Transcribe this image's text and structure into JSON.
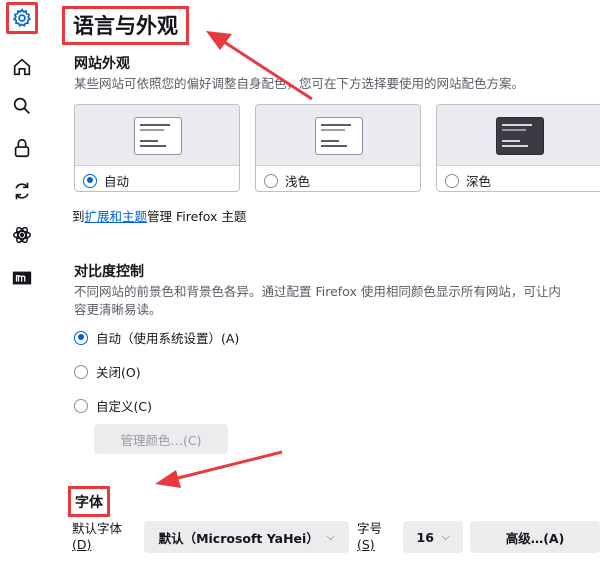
{
  "sidebar": {
    "items": [
      {
        "icon": "gear-icon",
        "active": true
      },
      {
        "icon": "home-icon"
      },
      {
        "icon": "search-icon"
      },
      {
        "icon": "lock-icon"
      },
      {
        "icon": "sync-icon"
      },
      {
        "icon": "atom-icon"
      },
      {
        "icon": "mozilla-m-icon"
      }
    ]
  },
  "section": {
    "title": "语言与外观",
    "website_appearance_heading": "网站外观",
    "website_appearance_desc": "某些网站可依照您的偏好调整自身配色，您可在下方选择要使用的网站配色方案。",
    "themes": [
      {
        "label": "自动",
        "selected": true
      },
      {
        "label": "浅色",
        "selected": false
      },
      {
        "label": "深色",
        "selected": false
      }
    ],
    "manage_prefix": "到",
    "manage_link": "扩展和主题",
    "manage_suffix": "管理 Firefox 主题"
  },
  "contrast": {
    "heading": "对比度控制",
    "desc_line1": "不同网站的前景色和背景色各异。通过配置 Firefox 使用相同颜色显示所有网站，可让内",
    "desc_line2": "容更清晰易读。",
    "options": [
      {
        "label": "自动（使用系统设置）(A)",
        "selected": true
      },
      {
        "label": "关闭(O)",
        "selected": false
      },
      {
        "label": "自定义(C)",
        "selected": false
      }
    ],
    "manage_colors_button": "管理颜色…(C)"
  },
  "fonts": {
    "heading": "字体",
    "default_font_label_line1": "默认字体",
    "default_font_label_line2": "(D)",
    "default_font_value": "默认（Microsoft YaHei）",
    "size_label_line1": "字号",
    "size_label_line2": "(S)",
    "size_value": "16",
    "advanced_button": "高级…(A)"
  },
  "colors": {
    "accent": "#0061e0",
    "annotation": "#e8393f"
  }
}
